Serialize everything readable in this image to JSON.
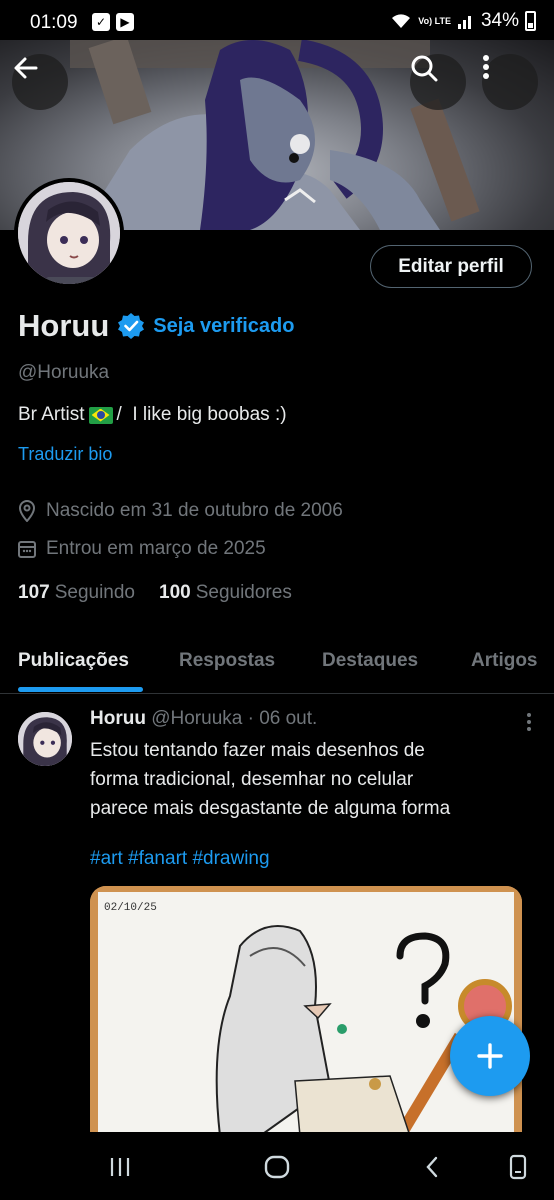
{
  "status_bar": {
    "time": "01:09",
    "network": "Vo) LTE",
    "battery_percent": "34%"
  },
  "header": {
    "back_icon": "arrow-left-icon",
    "search_icon": "search-icon",
    "more_icon": "more-vertical-icon"
  },
  "profile": {
    "edit_button_label": "Editar perfil",
    "name": "Horuu",
    "verify_label": "Seja verificado",
    "handle": "@Horuuka",
    "bio_prefix": "Br Artist",
    "bio_suffix": "/  I like big boobas :)",
    "translate_label": "Traduzir bio",
    "birth": "Nascido em 31 de outubro de 2006",
    "joined": "Entrou em março de 2025",
    "following_count": "107",
    "following_label": "Seguindo",
    "followers_count": "100",
    "followers_label": "Seguidores"
  },
  "tabs": [
    {
      "label": "Publicações",
      "active": true
    },
    {
      "label": "Respostas",
      "active": false
    },
    {
      "label": "Destaques",
      "active": false
    },
    {
      "label": "Artigos",
      "active": false
    }
  ],
  "post": {
    "author": "Horuu",
    "handle_date": "@Horuuka · 06 out.",
    "text_lines": [
      "Estou tentando fazer mais desenhos de",
      "forma tradicional, desemhar no celular",
      "parece mais desgastante de alguma forma"
    ],
    "hashtags": "#art #fanart #drawing",
    "image_date": "02/10/25"
  },
  "colors": {
    "accent": "#1d9bf0",
    "background": "#000000",
    "muted_text": "#71767b"
  }
}
